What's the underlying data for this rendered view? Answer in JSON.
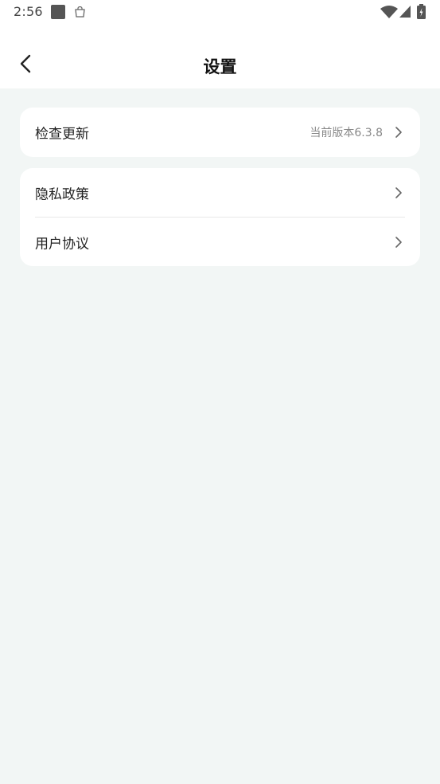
{
  "status_bar": {
    "time": "2:56",
    "icons": [
      "notification-square-icon",
      "shopping-bag-icon",
      "wifi-icon",
      "signal-icon",
      "battery-icon"
    ]
  },
  "header": {
    "back_icon": "chevron-left-icon",
    "title": "设置"
  },
  "settings": {
    "check_update": {
      "label": "检查更新",
      "value": "当前版本6.3.8"
    },
    "privacy_policy": {
      "label": "隐私政策"
    },
    "user_agreement": {
      "label": "用户协议"
    }
  },
  "colors": {
    "page_background": "#f2f6f5",
    "card_background": "#ffffff",
    "secondary_text": "#888888"
  }
}
